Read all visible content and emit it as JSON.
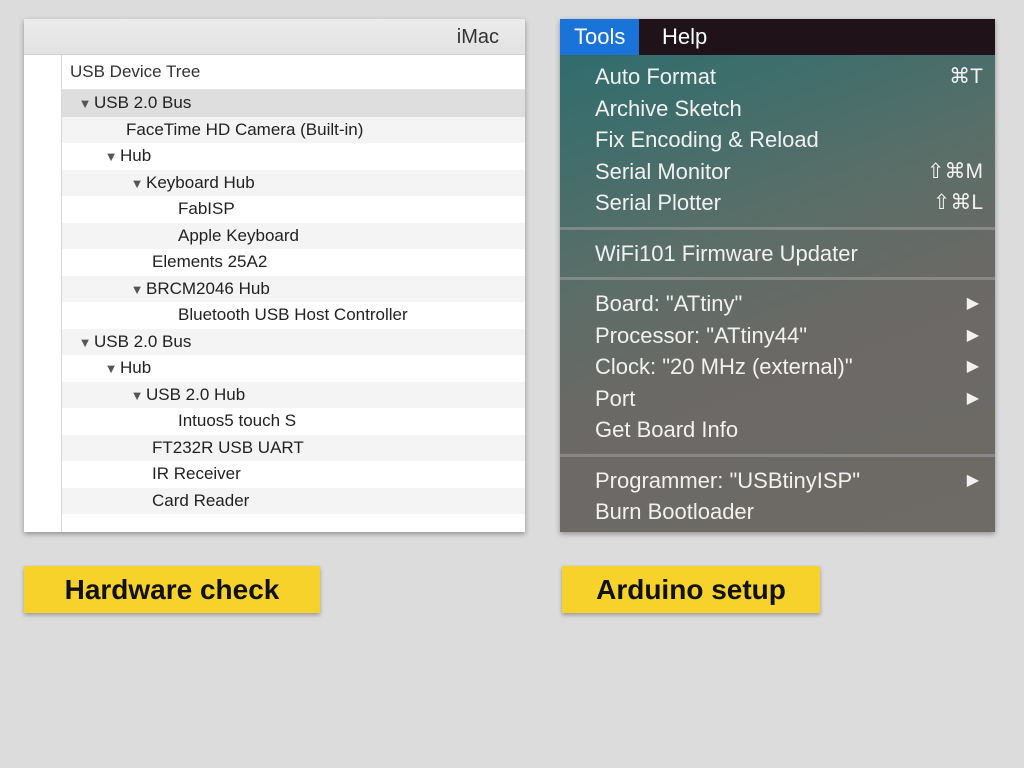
{
  "tree_panel": {
    "window_title": "iMac",
    "header": "USB Device Tree",
    "rows": [
      {
        "label": "USB 2.0 Bus",
        "level": 0,
        "expanded": true
      },
      {
        "label": "FaceTime HD Camera (Built-in)",
        "level": 1,
        "expanded": false
      },
      {
        "label": "Hub",
        "level": 1,
        "expanded": true
      },
      {
        "label": "Keyboard Hub",
        "level": 2,
        "expanded": true
      },
      {
        "label": "FabISP",
        "level": 3,
        "expanded": false
      },
      {
        "label": "Apple Keyboard",
        "level": 3,
        "expanded": false
      },
      {
        "label": "Elements 25A2",
        "level": 2,
        "expanded": false
      },
      {
        "label": "BRCM2046 Hub",
        "level": 2,
        "expanded": true
      },
      {
        "label": "Bluetooth USB Host Controller",
        "level": 3,
        "expanded": false
      },
      {
        "label": "USB 2.0 Bus",
        "level": 0,
        "expanded": true
      },
      {
        "label": "Hub",
        "level": 1,
        "expanded": true
      },
      {
        "label": "USB 2.0 Hub",
        "level": 2,
        "expanded": true
      },
      {
        "label": "Intuos5 touch S",
        "level": 3,
        "expanded": false
      },
      {
        "label": "FT232R USB UART",
        "level": 2,
        "expanded": false
      },
      {
        "label": "IR Receiver",
        "level": 2,
        "expanded": false
      },
      {
        "label": "Card Reader",
        "level": 2,
        "expanded": false
      }
    ],
    "expand_icon": "disclosure-triangle-down"
  },
  "menu_panel": {
    "menubar": {
      "tools": "Tools",
      "help": "Help"
    },
    "groups": [
      [
        {
          "label": "Auto Format",
          "shortcut": "⌘T"
        },
        {
          "label": "Archive Sketch",
          "shortcut": ""
        },
        {
          "label": "Fix Encoding & Reload",
          "shortcut": ""
        },
        {
          "label": "Serial Monitor",
          "shortcut": "⇧⌘M"
        },
        {
          "label": "Serial Plotter",
          "shortcut": "⇧⌘L"
        }
      ],
      [
        {
          "label": "WiFi101 Firmware Updater",
          "shortcut": ""
        }
      ],
      [
        {
          "label": "Board: \"ATtiny\"",
          "submenu": true
        },
        {
          "label": "Processor: \"ATtiny44\"",
          "submenu": true
        },
        {
          "label": "Clock: \"20 MHz (external)\"",
          "submenu": true
        },
        {
          "label": "Port",
          "submenu": true
        },
        {
          "label": "Get Board Info",
          "submenu": false
        }
      ],
      [
        {
          "label": "Programmer: \"USBtinyISP\"",
          "submenu": true
        },
        {
          "label": "Burn Bootloader",
          "submenu": false
        }
      ]
    ],
    "submenu_icon": "triangle-right"
  },
  "captions": {
    "left": "Hardware check",
    "right": "Arduino setup"
  },
  "colors": {
    "background": "#dcdcdd",
    "caption_bg": "#f6d22b",
    "menubar_active": "#1a73d9",
    "menubar_bg": "#1f1218"
  }
}
